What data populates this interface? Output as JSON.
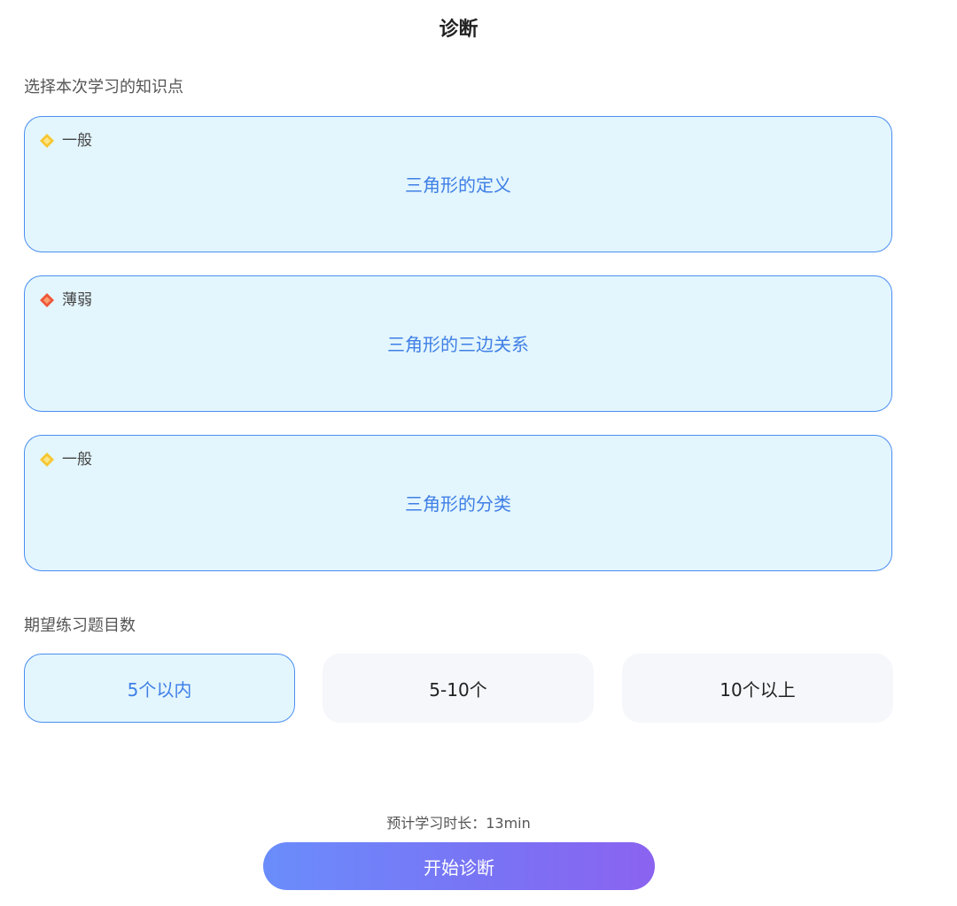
{
  "header": {
    "title": "诊断"
  },
  "knowledge": {
    "label": "选择本次学习的知识点",
    "items": [
      {
        "level": "一般",
        "name": "三角形的定义",
        "level_icon": "yellow-diamond-icon",
        "level_color": "#f5b91d"
      },
      {
        "level": "薄弱",
        "name": "三角形的三边关系",
        "level_icon": "red-diamond-icon",
        "level_color": "#f0563a"
      },
      {
        "level": "一般",
        "name": "三角形的分类",
        "level_icon": "yellow-diamond-icon",
        "level_color": "#f5b91d"
      }
    ]
  },
  "quantity": {
    "label": "期望练习题目数",
    "options": [
      "5个以内",
      "5-10个",
      "10个以上"
    ],
    "selected": "5个以内"
  },
  "footer": {
    "duration": "预计学习时长：13min",
    "start_label": "开始诊断"
  },
  "colors": {
    "accent": "#3f7fe6",
    "card_bg": "#e3f6fd",
    "card_border": "#4a8ef0",
    "button_gradient_start": "#6a8dfb",
    "button_gradient_end": "#8b63f0"
  }
}
